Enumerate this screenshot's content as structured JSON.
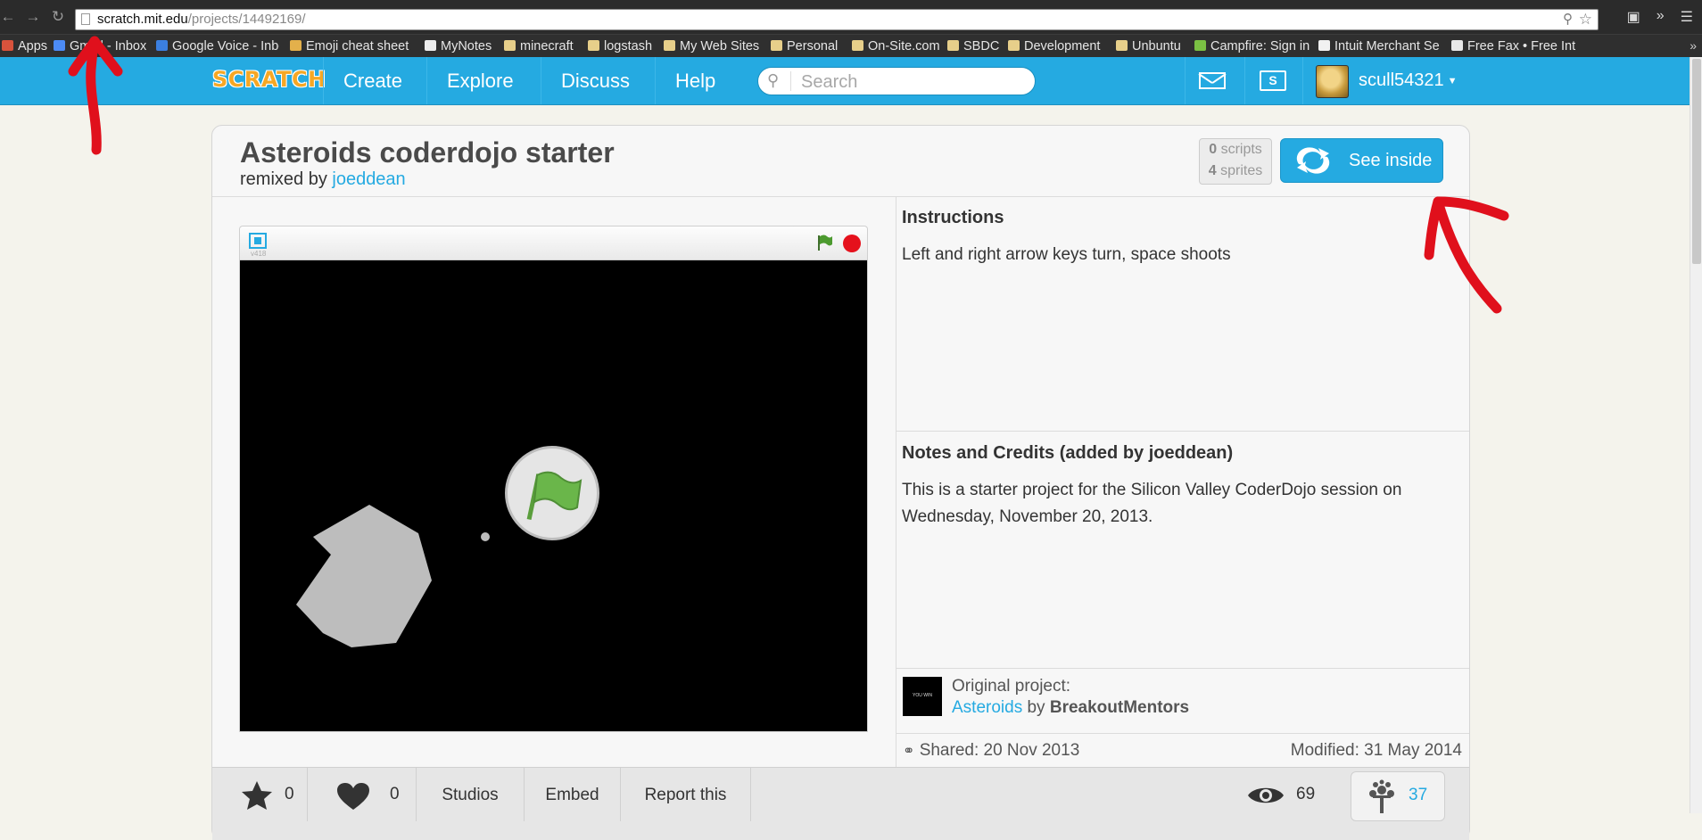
{
  "browser": {
    "url_host": "scratch.mit.edu",
    "url_path": "/projects/14492169/",
    "bookmarks": [
      {
        "label": "Apps",
        "icon": "apps-grid-icon"
      },
      {
        "label": "Gmail - Inbox",
        "icon": "gmail-icon"
      },
      {
        "label": "Google Voice - Inbox",
        "icon": "google-voice-icon"
      },
      {
        "label": "Emoji cheat sheet",
        "icon": "thumbs-up-icon"
      },
      {
        "label": "MyNotes",
        "icon": "page-icon"
      },
      {
        "label": "minecraft",
        "icon": "folder-icon"
      },
      {
        "label": "logstash",
        "icon": "folder-icon"
      },
      {
        "label": "My Web Sites",
        "icon": "folder-icon"
      },
      {
        "label": "Personal",
        "icon": "folder-icon"
      },
      {
        "label": "On-Site.com",
        "icon": "folder-icon"
      },
      {
        "label": "SBDC",
        "icon": "folder-icon"
      },
      {
        "label": "Development",
        "icon": "folder-icon"
      },
      {
        "label": "Unbuntu",
        "icon": "folder-icon"
      },
      {
        "label": "Campfire: Sign in",
        "icon": "campfire-icon"
      },
      {
        "label": "Intuit Merchant Se",
        "icon": "intuit-icon"
      },
      {
        "label": "Free Fax • Free Int",
        "icon": "freefax-icon"
      }
    ],
    "overflow_label": "»"
  },
  "header": {
    "logo_text": "SCRATCH",
    "nav": [
      "Create",
      "Explore",
      "Discuss",
      "Help"
    ],
    "search_placeholder": "Search",
    "username": "scull54321"
  },
  "project": {
    "title": "Asteroids coderdojo starter",
    "remixed_by_prefix": "remixed by",
    "remixed_by_user": "joeddean",
    "scripts_count": "0",
    "scripts_label": "scripts",
    "sprites_count": "4",
    "sprites_label": "sprites",
    "see_inside_label": "See inside",
    "player_version": "v418",
    "instructions_title": "Instructions",
    "instructions_text": "Left and right arrow keys turn, space shoots",
    "notes_title": "Notes and Credits (added by joeddean)",
    "notes_text": "This is a starter project for the Silicon Valley CoderDojo session on Wednesday, November 20, 2013.",
    "original_label": "Original project:",
    "original_title": "Asteroids",
    "original_by": "by",
    "original_author": "BreakoutMentors",
    "original_thumb_text": "YOU WIN",
    "shared": "Shared: 20 Nov 2013",
    "modified": "Modified: 31 May 2014"
  },
  "stats": {
    "favorites": "0",
    "loves": "0",
    "studios_label": "Studios",
    "embed_label": "Embed",
    "report_label": "Report this",
    "views": "69",
    "remixes": "37"
  },
  "colors": {
    "scratch_blue": "#25aae1",
    "annotation_red": "#e0101c",
    "stage_black": "#000000",
    "asteroid_gray": "#bdbdbd",
    "flag_green": "#6ab64a"
  }
}
